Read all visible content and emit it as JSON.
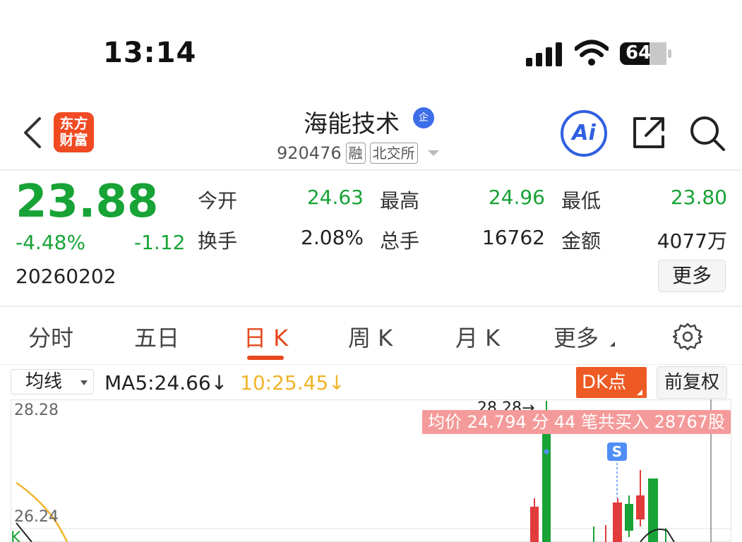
{
  "status_bar": {
    "time": "13:14",
    "battery_level": "64"
  },
  "header": {
    "logo_text": "东方财富",
    "stock_name": "海能技术",
    "name_badge": "企",
    "stock_code": "920476",
    "tags": [
      "融",
      "北交所"
    ],
    "ai_label": "Ai"
  },
  "quote": {
    "price": "23.88",
    "change_pct": "-4.48%",
    "change_value": "-1.12",
    "date": "20260202",
    "stats": [
      {
        "label": "今开",
        "value": "24.63"
      },
      {
        "label": "最高",
        "value": "24.96"
      },
      {
        "label": "最低",
        "value": "23.80"
      },
      {
        "label": "换手",
        "value": "2.08%"
      },
      {
        "label": "总手",
        "value": "16762"
      },
      {
        "label": "金额",
        "value": "4077万"
      }
    ],
    "more_label": "更多"
  },
  "tabs": {
    "items": [
      "分时",
      "五日",
      "日 K",
      "周 K",
      "月 K",
      "更多"
    ],
    "active": "日 K"
  },
  "indicator_bar": {
    "select_value": "均线",
    "ma5": "MA5:24.66↓",
    "time": "10:25.45↓",
    "dk_label": "DK点",
    "adjust_label": "前复权"
  },
  "chart": {
    "top_price": "28.28",
    "mid_price": "26.24",
    "peak_label": "28.28→",
    "left_marker": "K",
    "tooltip": "均价 24.794 分 44 笔共买入 28767股",
    "s_marker": "S",
    "colors": {
      "up": "#e23b3b",
      "down": "#17a336",
      "ma": "#f0b429"
    }
  }
}
